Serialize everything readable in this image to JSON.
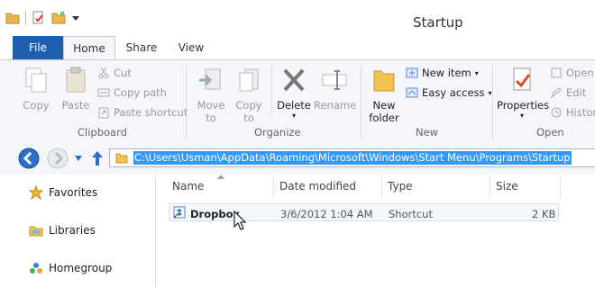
{
  "window": {
    "title": "Startup"
  },
  "tabs": {
    "file": "File",
    "home": "Home",
    "share": "Share",
    "view": "View"
  },
  "ribbon": {
    "clipboard": {
      "label": "Clipboard",
      "copy": "Copy",
      "paste": "Paste",
      "cut": "Cut",
      "copy_path": "Copy path",
      "paste_shortcut": "Paste shortcut"
    },
    "organize": {
      "label": "Organize",
      "move_to": "Move",
      "move_to_2": "to",
      "copy_to": "Copy",
      "copy_to_2": "to",
      "delete": "Delete",
      "rename": "Rename"
    },
    "new": {
      "label": "New",
      "new_folder": "New",
      "new_folder_2": "folder",
      "new_item": "New item",
      "easy_access": "Easy access"
    },
    "open": {
      "label": "Open",
      "properties": "Properties",
      "open": "Open",
      "edit": "Edit",
      "history": "History"
    }
  },
  "address": {
    "path": "C:\\Users\\Usman\\AppData\\Roaming\\Microsoft\\Windows\\Start Menu\\Programs\\Startup"
  },
  "nav": {
    "favorites": "Favorites",
    "libraries": "Libraries",
    "homegroup": "Homegroup"
  },
  "columns": {
    "name": "Name",
    "date": "Date modified",
    "type": "Type",
    "size": "Size"
  },
  "files": [
    {
      "name": "Dropbox",
      "date": "3/6/2012 1:04 AM",
      "type": "Shortcut",
      "size": "2 KB"
    }
  ]
}
